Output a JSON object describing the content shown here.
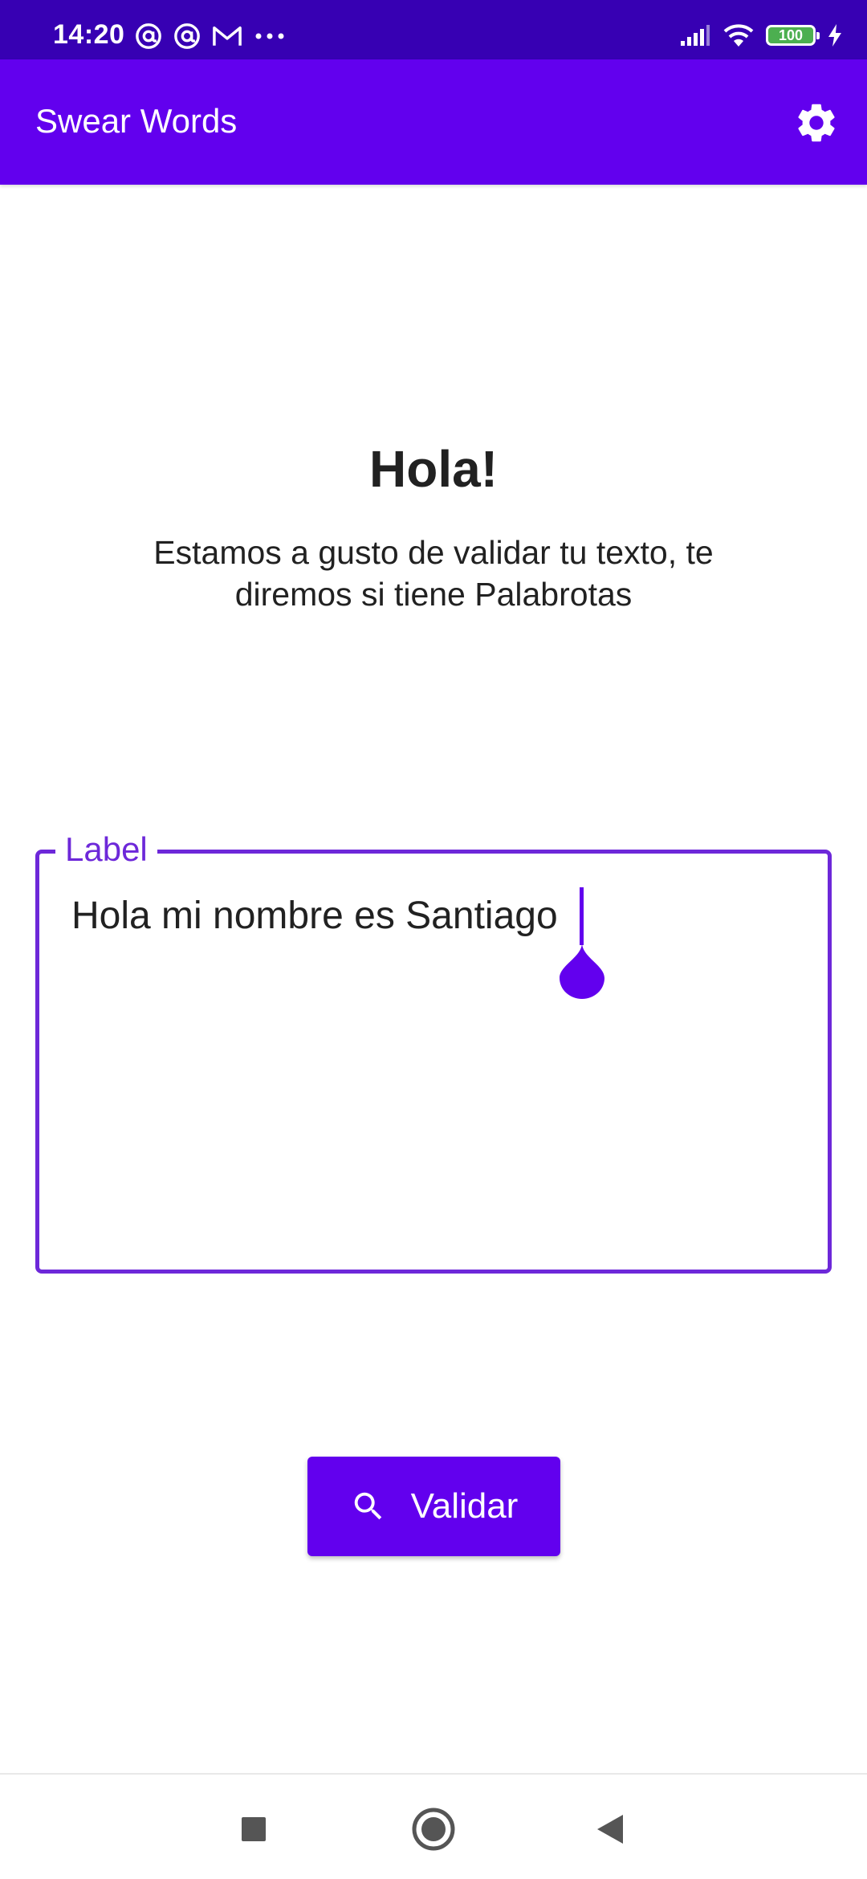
{
  "status_bar": {
    "time": "14:20",
    "left_icons": [
      "at-sign-icon",
      "at-sign-icon",
      "gmail-icon",
      "more-dots-icon"
    ],
    "right_icons": [
      "signal-icon",
      "wifi-icon",
      "battery-icon",
      "charging-icon"
    ],
    "battery_level": "100"
  },
  "app_bar": {
    "title": "Swear Words",
    "settings_icon": "gear-icon"
  },
  "greeting": {
    "title": "Hola!",
    "subtitle": "Estamos a gusto de validar tu texto, te diremos si tiene Palabrotas"
  },
  "text_field": {
    "label": "Label",
    "value": "Hola mi nombre es Santiago"
  },
  "validate_button": {
    "icon": "search-icon",
    "label": "Validar"
  },
  "nav_bar": {
    "items": [
      "recents-square-icon",
      "home-circle-icon",
      "back-triangle-icon"
    ]
  },
  "colors": {
    "status_bar": "#3700b3",
    "primary": "#6200ee",
    "field_outline": "#6d28d9",
    "text": "#212121",
    "battery": "#4caf50"
  }
}
